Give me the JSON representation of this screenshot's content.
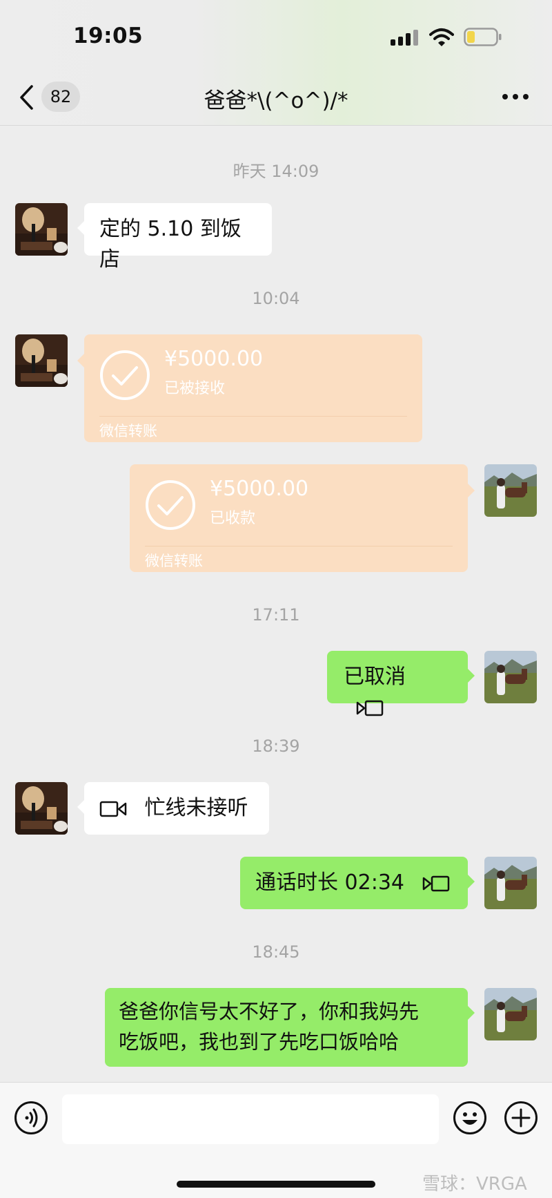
{
  "status_bar": {
    "time": "19:05"
  },
  "header": {
    "title": "爸爸*\\(^o^)/*",
    "unread_count": "82"
  },
  "messages": [
    {
      "kind": "timestamp",
      "text": "昨天 14:09"
    },
    {
      "kind": "text",
      "side": "left",
      "text": "定的 5.10 到饭店"
    },
    {
      "kind": "timestamp",
      "text": "10:04"
    },
    {
      "kind": "transfer",
      "side": "left",
      "amount": "¥5000.00",
      "status": "已被接收",
      "label": "微信转账"
    },
    {
      "kind": "transfer",
      "side": "right",
      "amount": "¥5000.00",
      "status": "已收款",
      "label": "微信转账"
    },
    {
      "kind": "timestamp",
      "text": "17:11"
    },
    {
      "kind": "call",
      "side": "right",
      "text": "已取消"
    },
    {
      "kind": "timestamp",
      "text": "18:39"
    },
    {
      "kind": "call",
      "side": "left",
      "text": "忙线未接听"
    },
    {
      "kind": "call",
      "side": "right",
      "text": "通话时长 02:34"
    },
    {
      "kind": "timestamp",
      "text": "18:45"
    },
    {
      "kind": "text",
      "side": "right",
      "lines": [
        "爸爸你信号太不好了，你和我妈先",
        "吃饭吧，我也到了先吃口饭哈哈"
      ]
    }
  ],
  "input_bar": {
    "value": "",
    "placeholder": ""
  },
  "watermark": "雪球：VRGA",
  "colors": {
    "background": "#ededed",
    "sent_bubble": "#95ec69",
    "received_bubble": "#ffffff",
    "transfer_bubble": "#fbdec2"
  },
  "icons": [
    "back-chevron-icon",
    "more-icon",
    "check-circle-icon",
    "video-call-icon",
    "voice-icon",
    "emoji-icon",
    "plus-icon"
  ]
}
